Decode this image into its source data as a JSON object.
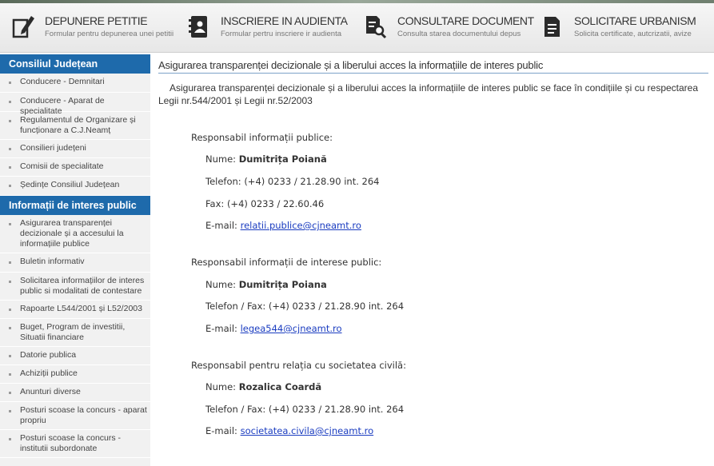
{
  "topnav": [
    {
      "title": "DEPUNERE PETITIE",
      "subtitle": "Formular pentru depunerea unei petitii",
      "icon": "pencil-edit-icon"
    },
    {
      "title": "INSCRIERE IN AUDIENTA",
      "subtitle": "Formular pertru inscriere ir audienta",
      "icon": "address-book-icon"
    },
    {
      "title": "CONSULTARE DOCUMENT",
      "subtitle": "Consulta starea documentului depus",
      "icon": "document-search-icon"
    },
    {
      "title": "SOLICITARE URBANISM",
      "subtitle": "Solicita certificate, autcrizatii, avize",
      "icon": "document-icon"
    }
  ],
  "sidebar": {
    "section1_title": "Consiliul Județean",
    "section1_items": [
      "Conducere - Demnitari",
      "Conducere - Aparat de specialitate",
      "Regulamentul de Organizare și funcționare a C.J.Neamț",
      "Consilieri județeni",
      "Comisii de specialitate",
      "Ședințe Consiliul Județean"
    ],
    "section2_title": "Informații de interes public",
    "section2_items": [
      "Asigurarea transparenței decizionale și a accesului la informațiile publice",
      "Buletin informativ",
      "Solicitarea informațiilor de interes public si modalitati de contestare",
      "Rapoarte L544/2001 și L52/2003",
      "Buget, Program de investitii, Situatii financiare",
      "Datorie publica",
      "Achiziții publice",
      "Anunturi diverse",
      "Posturi scoase la concurs - aparat propriu",
      "Posturi scoase la concurs - institutii subordonate"
    ]
  },
  "content": {
    "heading": "Asigurarea transparenței decizionale și a liberului acces la informațiile de interes public",
    "intro": "Asigurarea transparenței decizionale și a liberului acces la informațiile de interes public se face în condițiile și cu respectarea Legii nr.544/2001 și Legii nr.52/2003",
    "block1": {
      "title": "Responsabil informații publice:",
      "name_label": "Nume:",
      "name": "Dumitrița Poiană",
      "phone": "Telefon: (+4) 0233 / 21.28.90 int. 264",
      "fax": "Fax: (+4) 0233 / 22.60.46",
      "email_label": "E-mail:",
      "email": "relatii.publice@cjneamt.ro"
    },
    "block2": {
      "title": "Responsabil informații de interese public:",
      "name_label": "Nume:",
      "name": "Dumitrița Poiana",
      "phone": "Telefon / Fax: (+4) 0233 / 21.28.90 int. 264",
      "email_label": "E-mail:",
      "email": "legea544@cjneamt.ro"
    },
    "block3": {
      "title": "Responsabil pentru relația cu societatea civilă:",
      "name_label": "Nume:",
      "name": "Rozalica Coardă",
      "phone": "Telefon / Fax: (+4) 0233 / 21.28.90 int. 264",
      "email_label": "E-mail:",
      "email": "societatea.civila@cjneamt.ro"
    }
  }
}
